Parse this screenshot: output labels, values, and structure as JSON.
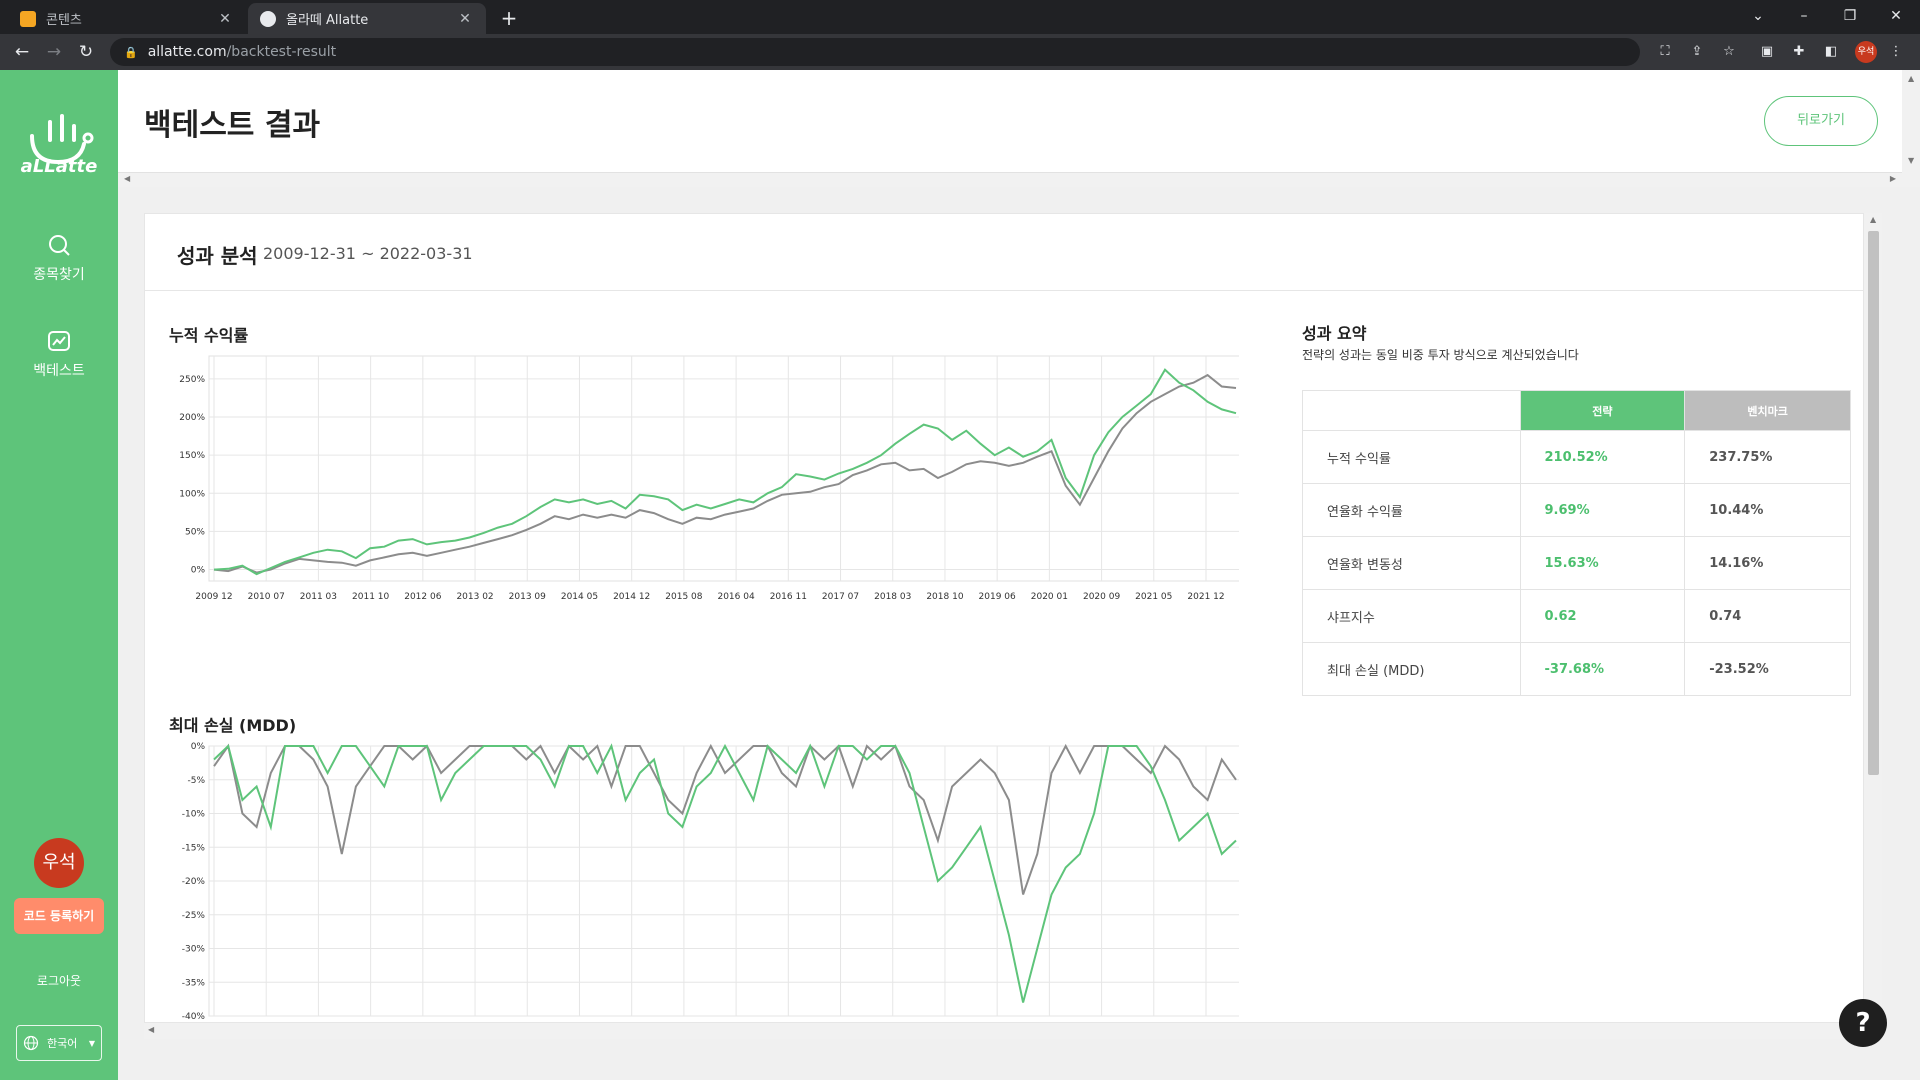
{
  "browser": {
    "tabs": [
      {
        "title": "콘텐츠",
        "active": false,
        "favicon_color": "#f5a623"
      },
      {
        "title": "올라떼 Allatte",
        "active": true,
        "favicon_color": "#e8eaed"
      }
    ],
    "url_host": "allatte.com",
    "url_path": "/backtest-result",
    "profile_label": "우석"
  },
  "sidebar": {
    "logo_text": "aLLatte",
    "nav": [
      {
        "label": "종목찾기",
        "icon": "search-icon"
      },
      {
        "label": "백테스트",
        "icon": "chart-icon"
      }
    ],
    "avatar_label": "우석",
    "code_button": "코드 등록하기",
    "logout": "로그아웃",
    "language": "한국어"
  },
  "header": {
    "title": "백테스트 결과",
    "back_button": "뒤로가기"
  },
  "card": {
    "title": "성과 분석",
    "range": "2009-12-31 ~ 2022-03-31"
  },
  "summary": {
    "title": "성과 요약",
    "subtitle": "전략의 성과는 동일 비중 투자 방식으로 계산되었습니다",
    "col_strategy": "전략",
    "col_benchmark": "벤치마크",
    "rows": [
      {
        "label": "누적 수익률",
        "strategy": "210.52%",
        "benchmark": "237.75%"
      },
      {
        "label": "연율화 수익률",
        "strategy": "9.69%",
        "benchmark": "10.44%"
      },
      {
        "label": "연율화 변동성",
        "strategy": "15.63%",
        "benchmark": "14.16%"
      },
      {
        "label": "샤프지수",
        "strategy": "0.62",
        "benchmark": "0.74"
      },
      {
        "label": "최대 손실 (MDD)",
        "strategy": "-37.68%",
        "benchmark": "-23.52%"
      }
    ]
  },
  "colors": {
    "strategy": "#5ec47a",
    "benchmark": "#8c8c8c",
    "brand": "#5ec47a"
  },
  "chart_data": [
    {
      "type": "line",
      "title": "누적 수익률",
      "x_ticks": [
        "2009 12",
        "2010 07",
        "2011 03",
        "2011 10",
        "2012 06",
        "2013 02",
        "2013 09",
        "2014 05",
        "2014 12",
        "2015 08",
        "2016 04",
        "2016 11",
        "2017 07",
        "2018 03",
        "2018 10",
        "2019 06",
        "2020 01",
        "2020 09",
        "2021 05",
        "2021 12"
      ],
      "y_ticks": [
        "0%",
        "50%",
        "100%",
        "150%",
        "200%",
        "250%"
      ],
      "ylim": [
        -15,
        280
      ],
      "grid": true,
      "series": [
        {
          "name": "전략",
          "values": [
            0,
            1,
            5,
            -6,
            2,
            10,
            16,
            22,
            26,
            24,
            15,
            28,
            30,
            38,
            40,
            33,
            36,
            38,
            42,
            48,
            55,
            60,
            70,
            82,
            92,
            88,
            92,
            86,
            90,
            80,
            98,
            96,
            92,
            78,
            85,
            80,
            86,
            92,
            88,
            100,
            108,
            125,
            122,
            118,
            126,
            132,
            140,
            150,
            165,
            178,
            190,
            185,
            170,
            182,
            165,
            150,
            160,
            148,
            155,
            170,
            120,
            95,
            150,
            180,
            200,
            215,
            230,
            262,
            245,
            235,
            220,
            210,
            205
          ]
        },
        {
          "name": "벤치마크",
          "values": [
            0,
            -2,
            4,
            -4,
            0,
            8,
            14,
            12,
            10,
            9,
            5,
            12,
            16,
            20,
            22,
            18,
            22,
            26,
            30,
            35,
            40,
            45,
            52,
            60,
            70,
            66,
            72,
            68,
            72,
            68,
            78,
            74,
            66,
            60,
            68,
            66,
            72,
            76,
            80,
            90,
            98,
            100,
            102,
            108,
            112,
            124,
            130,
            138,
            140,
            130,
            132,
            120,
            128,
            138,
            142,
            140,
            136,
            140,
            148,
            155,
            110,
            85,
            120,
            155,
            185,
            205,
            220,
            230,
            240,
            245,
            255,
            240,
            238
          ]
        }
      ]
    },
    {
      "type": "line",
      "title": "최대 손실 (MDD)",
      "y_ticks": [
        "0%",
        "-5%",
        "-10%",
        "-15%",
        "-20%",
        "-25%",
        "-30%",
        "-35%",
        "-40%"
      ],
      "ylim": [
        -40,
        0
      ],
      "grid": true,
      "series": [
        {
          "name": "전략",
          "values": [
            -2,
            0,
            -8,
            -6,
            -12,
            0,
            0,
            0,
            -4,
            0,
            0,
            -3,
            -6,
            0,
            0,
            0,
            -8,
            -4,
            -2,
            0,
            0,
            0,
            0,
            -2,
            -6,
            0,
            0,
            -4,
            0,
            -8,
            -4,
            -2,
            -10,
            -12,
            -6,
            -4,
            0,
            -4,
            -8,
            0,
            -2,
            -4,
            0,
            -6,
            0,
            0,
            -2,
            0,
            0,
            -4,
            -12,
            -20,
            -18,
            -15,
            -12,
            -20,
            -28,
            -38,
            -30,
            -22,
            -18,
            -16,
            -10,
            0,
            0,
            0,
            -3,
            -8,
            -14,
            -12,
            -10,
            -16,
            -14
          ]
        },
        {
          "name": "벤치마크",
          "values": [
            -3,
            0,
            -10,
            -12,
            -4,
            0,
            0,
            -2,
            -6,
            -16,
            -6,
            -3,
            0,
            0,
            -2,
            0,
            -4,
            -2,
            0,
            0,
            0,
            0,
            -2,
            0,
            -4,
            0,
            -2,
            0,
            -6,
            0,
            0,
            -4,
            -8,
            -10,
            -4,
            0,
            -4,
            -2,
            0,
            0,
            -4,
            -6,
            0,
            -2,
            0,
            -6,
            0,
            -2,
            0,
            -6,
            -8,
            -14,
            -6,
            -4,
            -2,
            -4,
            -8,
            -22,
            -16,
            -4,
            0,
            -4,
            0,
            0,
            0,
            -2,
            -4,
            0,
            -2,
            -6,
            -8,
            -2,
            -5
          ]
        }
      ]
    }
  ]
}
